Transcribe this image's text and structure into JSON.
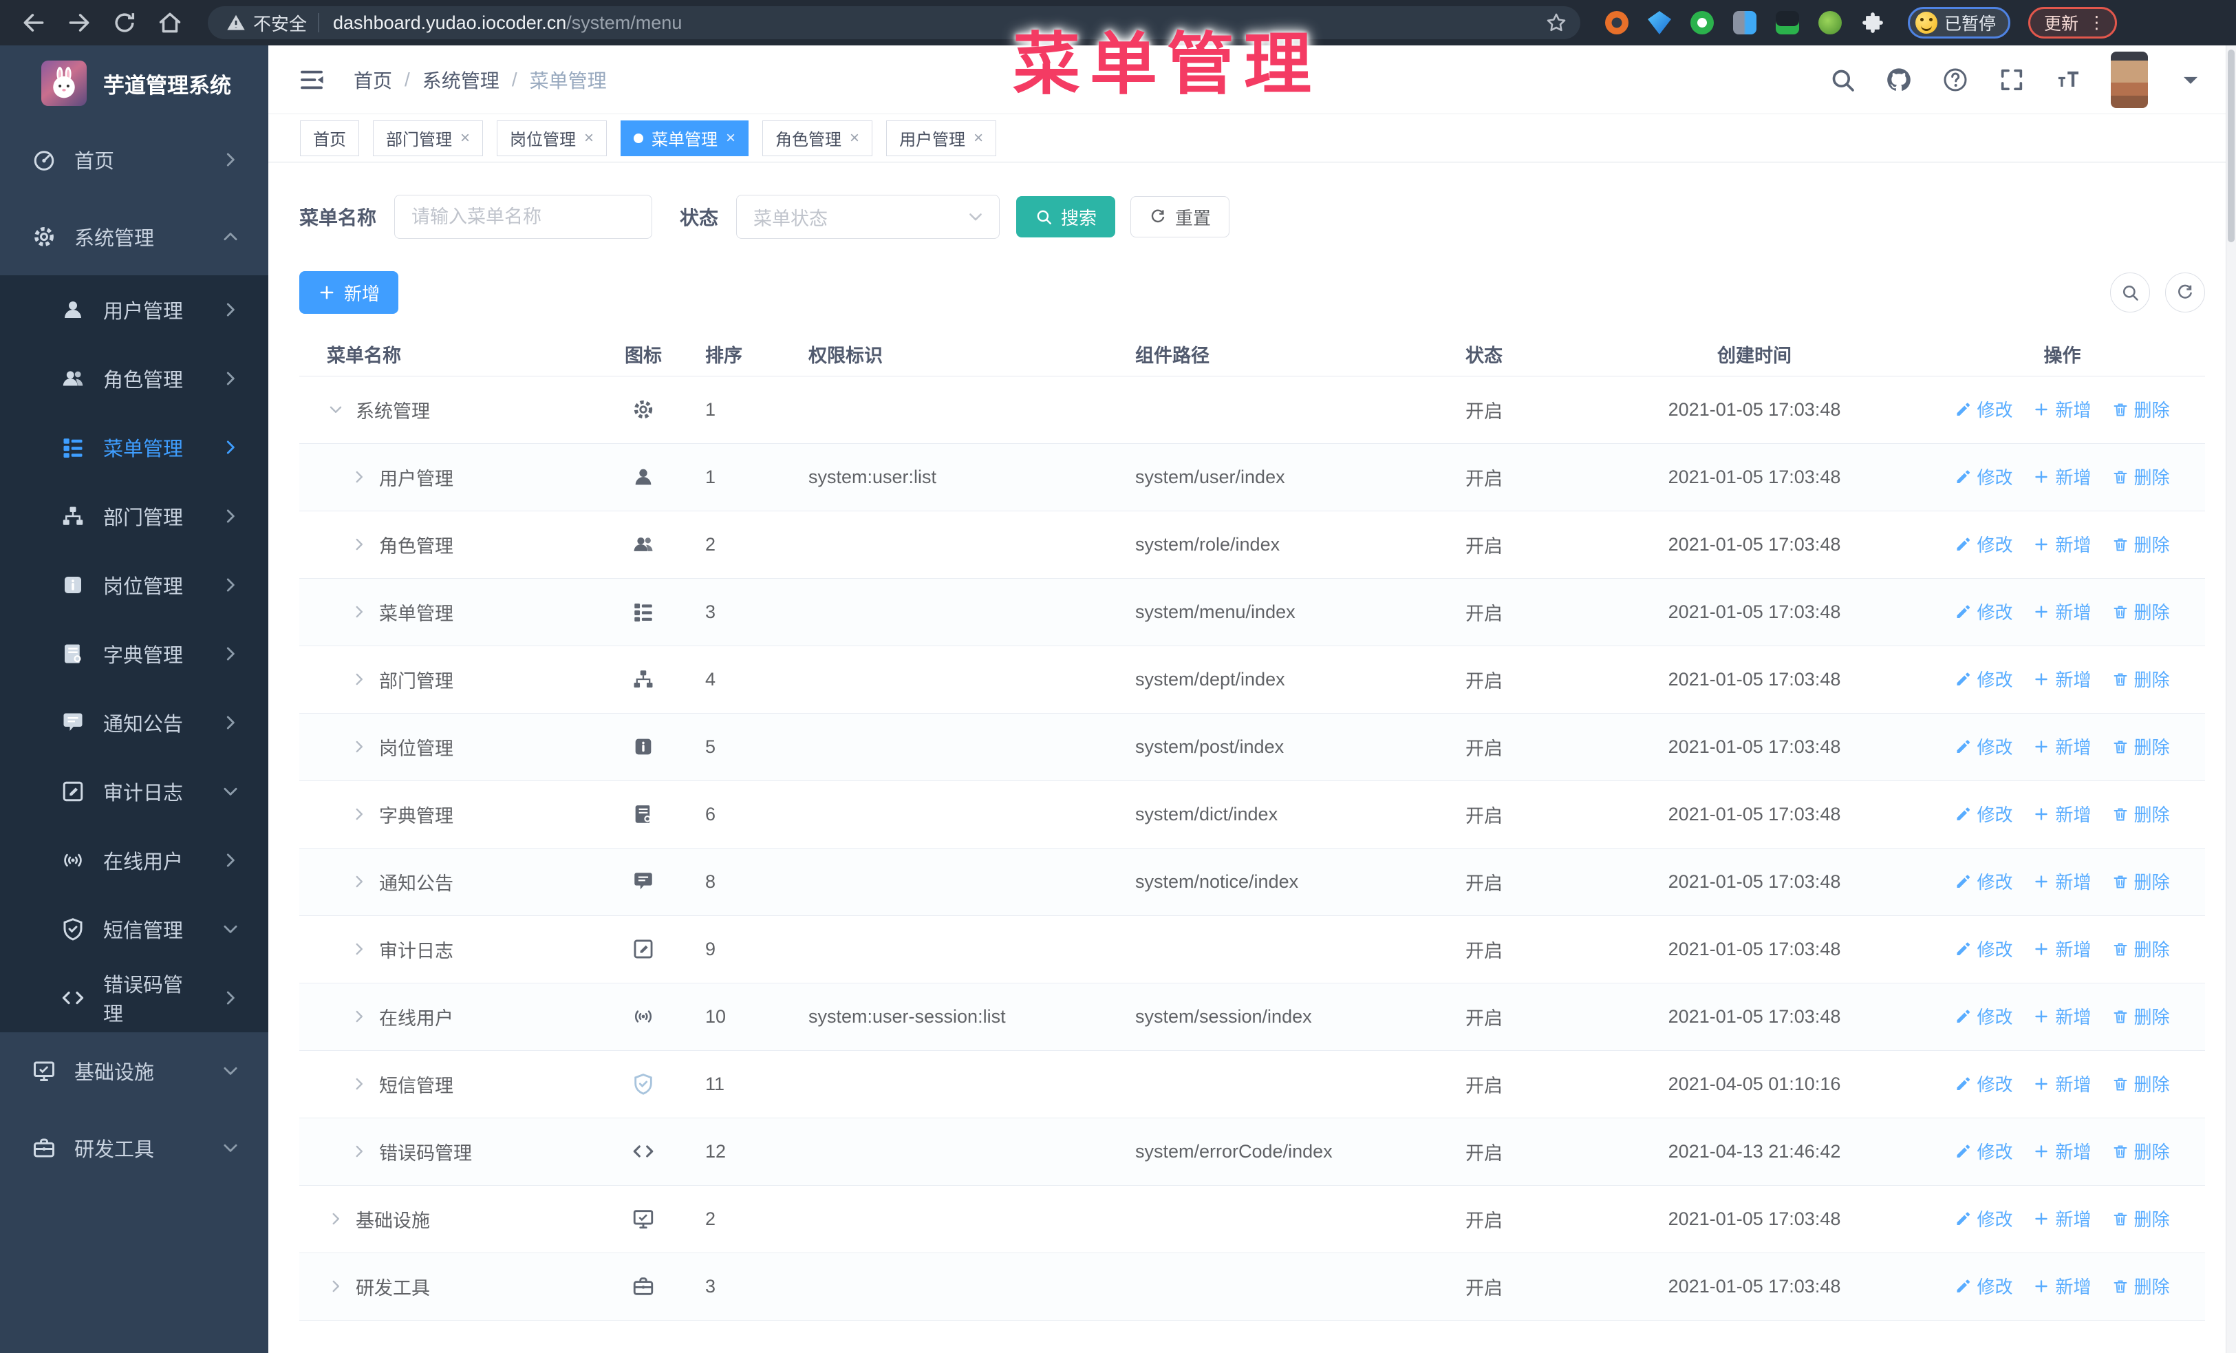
{
  "overlay": {
    "title": "菜单管理"
  },
  "browser": {
    "security_label": "不安全",
    "url_host": "dashboard.yudao.iocoder.cn",
    "url_path": "/system/menu",
    "paused_label": "已暂停",
    "update_label": "更新"
  },
  "sidebar": {
    "app_title": "芋道管理系统",
    "items": [
      {
        "label": "首页",
        "icon": "dashboard",
        "type": "top"
      },
      {
        "label": "系统管理",
        "icon": "gear",
        "type": "top",
        "caret": "up"
      },
      {
        "label": "用户管理",
        "icon": "user",
        "type": "sub"
      },
      {
        "label": "角色管理",
        "icon": "users",
        "type": "sub"
      },
      {
        "label": "菜单管理",
        "icon": "menu",
        "type": "sub",
        "active": true
      },
      {
        "label": "部门管理",
        "icon": "tree",
        "type": "sub"
      },
      {
        "label": "岗位管理",
        "icon": "post",
        "type": "sub"
      },
      {
        "label": "字典管理",
        "icon": "dict",
        "type": "sub"
      },
      {
        "label": "通知公告",
        "icon": "message",
        "type": "sub"
      },
      {
        "label": "审计日志",
        "icon": "log",
        "type": "sub",
        "caret": "down"
      },
      {
        "label": "在线用户",
        "icon": "online",
        "type": "sub"
      },
      {
        "label": "短信管理",
        "icon": "shield",
        "type": "sub",
        "caret": "down"
      },
      {
        "label": "错误码管理",
        "icon": "code",
        "type": "sub"
      },
      {
        "label": "基础设施",
        "icon": "monitor",
        "type": "top",
        "caret": "down"
      },
      {
        "label": "研发工具",
        "icon": "tool",
        "type": "top",
        "caret": "down"
      }
    ]
  },
  "header": {
    "breadcrumbs": [
      "首页",
      "系统管理",
      "菜单管理"
    ]
  },
  "tags": [
    {
      "label": "首页",
      "closable": false,
      "active": false
    },
    {
      "label": "部门管理",
      "closable": true,
      "active": false
    },
    {
      "label": "岗位管理",
      "closable": true,
      "active": false
    },
    {
      "label": "菜单管理",
      "closable": true,
      "active": true
    },
    {
      "label": "角色管理",
      "closable": true,
      "active": false
    },
    {
      "label": "用户管理",
      "closable": true,
      "active": false
    }
  ],
  "filters": {
    "name_label": "菜单名称",
    "name_placeholder": "请输入菜单名称",
    "status_label": "状态",
    "status_placeholder": "菜单状态",
    "search_label": "搜索",
    "reset_label": "重置"
  },
  "toolbar": {
    "add_label": "新增"
  },
  "table": {
    "columns": [
      "菜单名称",
      "图标",
      "排序",
      "权限标识",
      "组件路径",
      "状态",
      "创建时间",
      "操作"
    ],
    "row_actions": {
      "edit": "修改",
      "add": "新增",
      "delete": "删除"
    },
    "rows": [
      {
        "name": "系统管理",
        "icon": "gear",
        "level": 0,
        "expanded": true,
        "order": "1",
        "perm": "",
        "path": "",
        "status": "开启",
        "time": "2021-01-05 17:03:48"
      },
      {
        "name": "用户管理",
        "icon": "user",
        "level": 1,
        "expanded": false,
        "order": "1",
        "perm": "system:user:list",
        "path": "system/user/index",
        "status": "开启",
        "time": "2021-01-05 17:03:48"
      },
      {
        "name": "角色管理",
        "icon": "users",
        "level": 1,
        "expanded": false,
        "order": "2",
        "perm": "",
        "path": "system/role/index",
        "status": "开启",
        "time": "2021-01-05 17:03:48"
      },
      {
        "name": "菜单管理",
        "icon": "menu",
        "level": 1,
        "expanded": false,
        "order": "3",
        "perm": "",
        "path": "system/menu/index",
        "status": "开启",
        "time": "2021-01-05 17:03:48"
      },
      {
        "name": "部门管理",
        "icon": "tree",
        "level": 1,
        "expanded": false,
        "order": "4",
        "perm": "",
        "path": "system/dept/index",
        "status": "开启",
        "time": "2021-01-05 17:03:48"
      },
      {
        "name": "岗位管理",
        "icon": "post",
        "level": 1,
        "expanded": false,
        "order": "5",
        "perm": "",
        "path": "system/post/index",
        "status": "开启",
        "time": "2021-01-05 17:03:48"
      },
      {
        "name": "字典管理",
        "icon": "dict",
        "level": 1,
        "expanded": false,
        "order": "6",
        "perm": "",
        "path": "system/dict/index",
        "status": "开启",
        "time": "2021-01-05 17:03:48"
      },
      {
        "name": "通知公告",
        "icon": "message",
        "level": 1,
        "expanded": false,
        "order": "8",
        "perm": "",
        "path": "system/notice/index",
        "status": "开启",
        "time": "2021-01-05 17:03:48"
      },
      {
        "name": "审计日志",
        "icon": "log",
        "level": 1,
        "expanded": false,
        "order": "9",
        "perm": "",
        "path": "",
        "status": "开启",
        "time": "2021-01-05 17:03:48"
      },
      {
        "name": "在线用户",
        "icon": "online",
        "level": 1,
        "expanded": false,
        "order": "10",
        "perm": "system:user-session:list",
        "path": "system/session/index",
        "status": "开启",
        "time": "2021-01-05 17:03:48"
      },
      {
        "name": "短信管理",
        "icon": "shield",
        "level": 1,
        "expanded": false,
        "order": "11",
        "perm": "",
        "path": "",
        "status": "开启",
        "time": "2021-04-05 01:10:16",
        "muted_icon": true
      },
      {
        "name": "错误码管理",
        "icon": "code",
        "level": 1,
        "expanded": false,
        "order": "12",
        "perm": "",
        "path": "system/errorCode/index",
        "status": "开启",
        "time": "2021-04-13 21:46:42"
      },
      {
        "name": "基础设施",
        "icon": "monitor",
        "level": 0,
        "expanded": false,
        "order": "2",
        "perm": "",
        "path": "",
        "status": "开启",
        "time": "2021-01-05 17:03:48"
      },
      {
        "name": "研发工具",
        "icon": "tool",
        "level": 0,
        "expanded": false,
        "order": "3",
        "perm": "",
        "path": "",
        "status": "开启",
        "time": "2021-01-05 17:03:48"
      }
    ]
  }
}
